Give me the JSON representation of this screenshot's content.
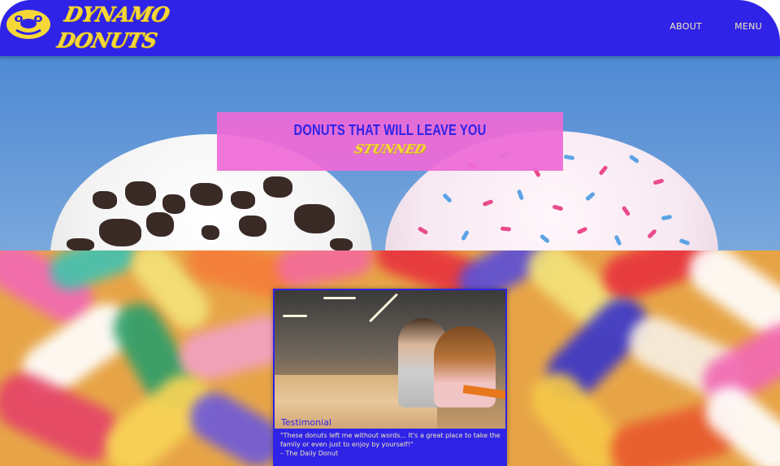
{
  "nav": {
    "brand_line1": "DYNAMO",
    "brand_line2": "DONUTS",
    "links": [
      "ABOUT",
      "MENU"
    ]
  },
  "hero": {
    "headline": "DONUTS THAT WILL LEAVE YOU",
    "emphasis": "STUNNED"
  },
  "testimonial": {
    "title": "Testimonial",
    "quote": "\"These donuts left me without words... It's a great place to take the family or even just to enjoy by yourself!\"",
    "source": "– The Daily Donut"
  },
  "icons": [
    "donut-logo-icon"
  ],
  "colors": {
    "nav_background": "#2f23e8",
    "brand_yellow": "#f5d838",
    "banner_pink": "#ee6bd6",
    "nav_link": "#f0e9b6"
  }
}
